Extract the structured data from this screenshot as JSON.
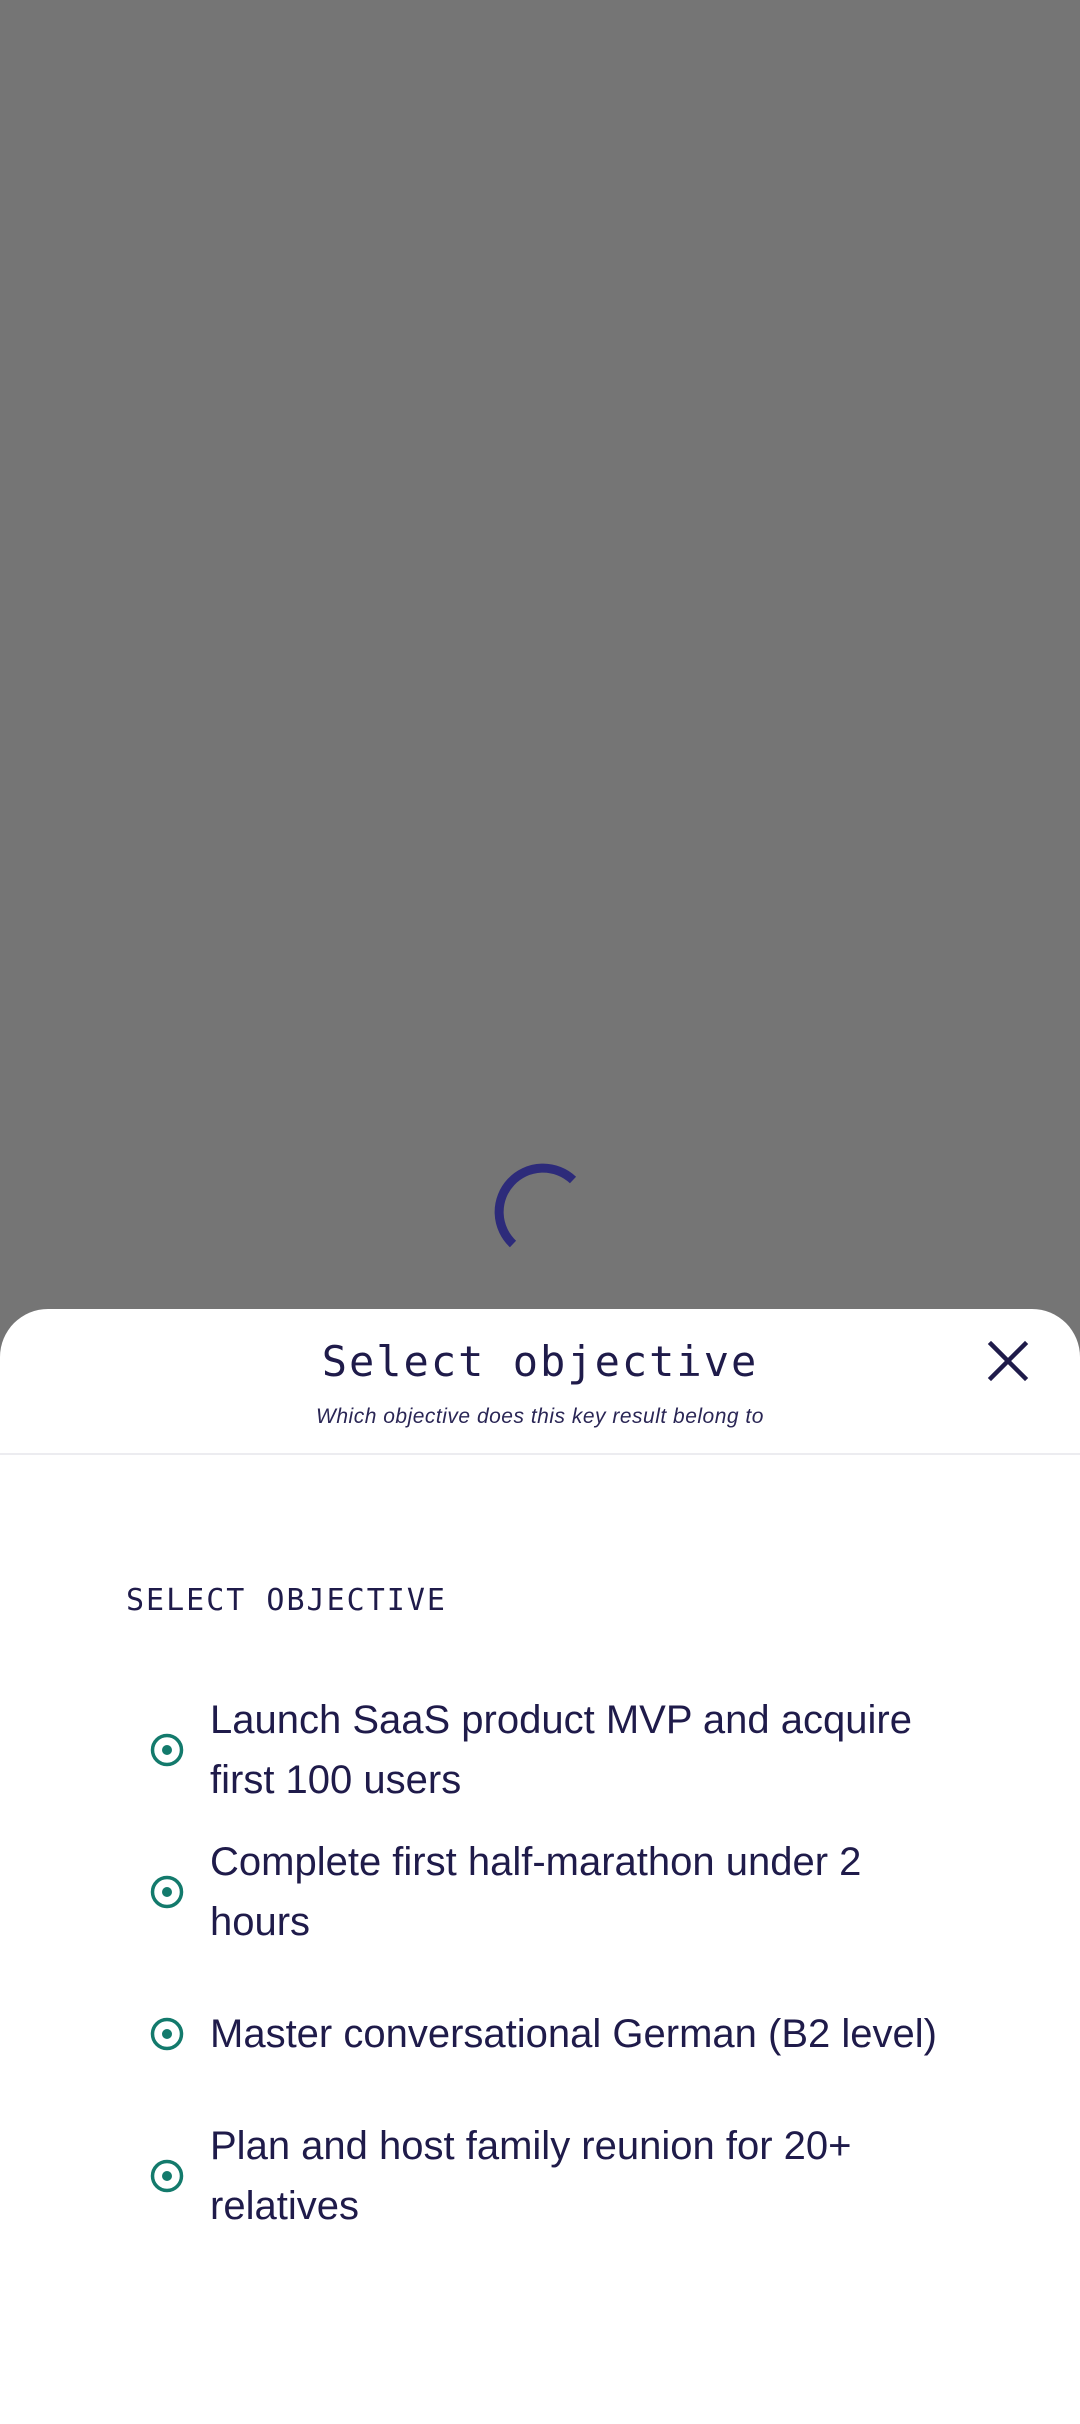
{
  "background": {
    "scrim_color": "#757575",
    "spinner_color": "#2d2b7a",
    "spinner_icon": "loading-spinner-icon"
  },
  "sheet": {
    "title": "Select objective",
    "subtitle": "Which objective does this key result belong to",
    "close_icon": "close-icon",
    "section_label": "SELECT OBJECTIVE",
    "accent_color": "#137a6c",
    "options": [
      {
        "label": "Launch SaaS product MVP and acquire first 100 users"
      },
      {
        "label": "Complete first half-marathon under 2 hours"
      },
      {
        "label": "Master conversational German (B2 level)"
      },
      {
        "label": "Plan and host family reunion for 20+ relatives"
      }
    ]
  }
}
